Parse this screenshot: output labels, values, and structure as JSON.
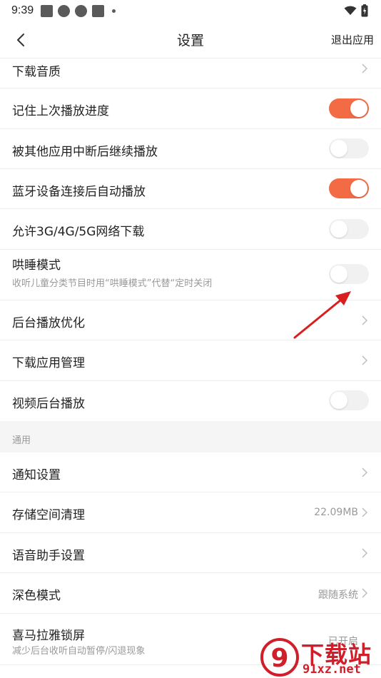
{
  "status": {
    "time": "9:39"
  },
  "nav": {
    "title": "设置",
    "action": "退出应用"
  },
  "rows": [
    {
      "title": "下载音质"
    },
    {
      "title": "记住上次播放进度",
      "toggle": "on"
    },
    {
      "title": "被其他应用中断后继续播放",
      "toggle": "off"
    },
    {
      "title": "蓝牙设备连接后自动播放",
      "toggle": "on"
    },
    {
      "title": "允许3G/4G/5G网络下载",
      "toggle": "off"
    },
    {
      "title": "哄睡模式",
      "subtitle": "收听儿童分类节目时用“哄睡模式”代替“定时关闭",
      "toggle": "off"
    },
    {
      "title": "后台播放优化"
    },
    {
      "title": "下载应用管理"
    },
    {
      "title": "视频后台播放",
      "toggle": "off"
    }
  ],
  "section": {
    "label": "通用"
  },
  "general_rows": [
    {
      "title": "通知设置"
    },
    {
      "title": "存储空间清理",
      "value": "22.09MB"
    },
    {
      "title": "语音助手设置"
    },
    {
      "title": "深色模式",
      "value": "跟随系统"
    },
    {
      "title": "喜马拉雅锁屏",
      "subtitle": "减少后台收听自动暂停/闪退现象",
      "value": "已开启"
    }
  ],
  "watermark": {
    "main": "下载站",
    "url": "91xz.net",
    "logo": "9"
  },
  "colors": {
    "accent": "#f26b45",
    "toggle_off": "#f1f1f1",
    "annotation_arrow": "#d81e1e"
  }
}
